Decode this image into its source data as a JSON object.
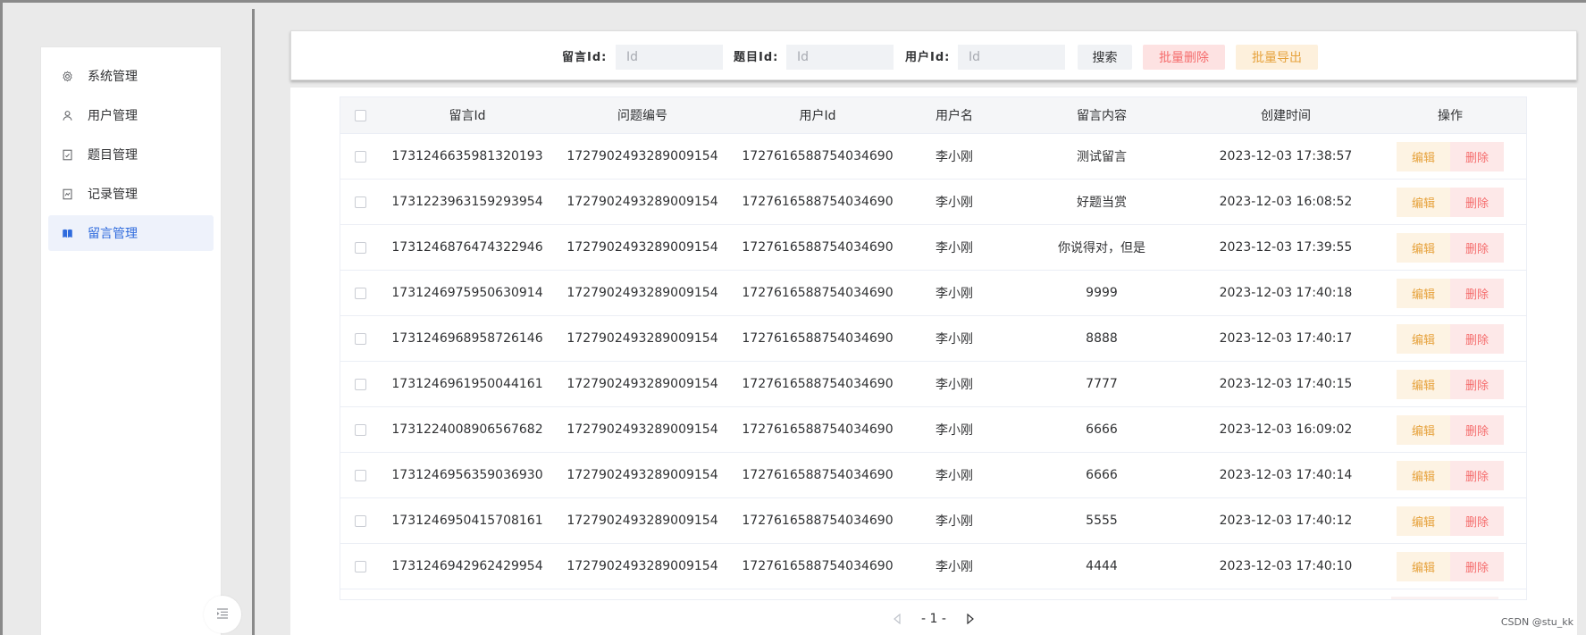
{
  "sidebar": {
    "items": [
      {
        "label": "系统管理",
        "icon": "gear-icon",
        "active": false
      },
      {
        "label": "用户管理",
        "icon": "user-icon",
        "active": false
      },
      {
        "label": "题目管理",
        "icon": "document-icon",
        "active": false
      },
      {
        "label": "记录管理",
        "icon": "record-icon",
        "active": false
      },
      {
        "label": "留言管理",
        "icon": "book-icon",
        "active": true
      }
    ]
  },
  "search": {
    "message_id_label": "留言Id:",
    "message_id_placeholder": "Id",
    "message_id_value": "",
    "question_id_label": "题目Id:",
    "question_id_placeholder": "Id",
    "question_id_value": "",
    "user_id_label": "用户Id:",
    "user_id_placeholder": "Id",
    "user_id_value": "",
    "search_label": "搜索",
    "batch_delete_label": "批量删除",
    "batch_export_label": "批量导出"
  },
  "table": {
    "columns": {
      "message_id": "留言Id",
      "question_no": "问题编号",
      "user_id": "用户Id",
      "user_name": "用户名",
      "content": "留言内容",
      "created_at": "创建时间",
      "actions": "操作"
    },
    "edit_label": "编辑",
    "delete_label": "删除",
    "rows": [
      {
        "message_id": "1731246635981320193",
        "question_no": "1727902493289009154",
        "user_id": "1727616588754034690",
        "user_name": "李小刚",
        "content": "测试留言",
        "created_at": "2023-12-03 17:38:57"
      },
      {
        "message_id": "1731223963159293954",
        "question_no": "1727902493289009154",
        "user_id": "1727616588754034690",
        "user_name": "李小刚",
        "content": "好题当赏",
        "created_at": "2023-12-03 16:08:52"
      },
      {
        "message_id": "1731246876474322946",
        "question_no": "1727902493289009154",
        "user_id": "1727616588754034690",
        "user_name": "李小刚",
        "content": "你说得对，但是",
        "created_at": "2023-12-03 17:39:55"
      },
      {
        "message_id": "1731246975950630914",
        "question_no": "1727902493289009154",
        "user_id": "1727616588754034690",
        "user_name": "李小刚",
        "content": "9999",
        "created_at": "2023-12-03 17:40:18"
      },
      {
        "message_id": "1731246968958726146",
        "question_no": "1727902493289009154",
        "user_id": "1727616588754034690",
        "user_name": "李小刚",
        "content": "8888",
        "created_at": "2023-12-03 17:40:17"
      },
      {
        "message_id": "1731246961950044161",
        "question_no": "1727902493289009154",
        "user_id": "1727616588754034690",
        "user_name": "李小刚",
        "content": "7777",
        "created_at": "2023-12-03 17:40:15"
      },
      {
        "message_id": "1731224008906567682",
        "question_no": "1727902493289009154",
        "user_id": "1727616588754034690",
        "user_name": "李小刚",
        "content": "6666",
        "created_at": "2023-12-03 16:09:02"
      },
      {
        "message_id": "1731246956359036930",
        "question_no": "1727902493289009154",
        "user_id": "1727616588754034690",
        "user_name": "李小刚",
        "content": "6666",
        "created_at": "2023-12-03 17:40:14"
      },
      {
        "message_id": "1731246950415708161",
        "question_no": "1727902493289009154",
        "user_id": "1727616588754034690",
        "user_name": "李小刚",
        "content": "5555",
        "created_at": "2023-12-03 17:40:12"
      },
      {
        "message_id": "1731246942962429954",
        "question_no": "1727902493289009154",
        "user_id": "1727616588754034690",
        "user_name": "李小刚",
        "content": "4444",
        "created_at": "2023-12-03 17:40:10"
      }
    ]
  },
  "pagination": {
    "page_text": "- 1 -"
  },
  "watermark": "CSDN @stu_kk",
  "colors": {
    "accent": "#2f6bdd",
    "danger": "#f56c6c",
    "warning": "#e6a23c"
  }
}
